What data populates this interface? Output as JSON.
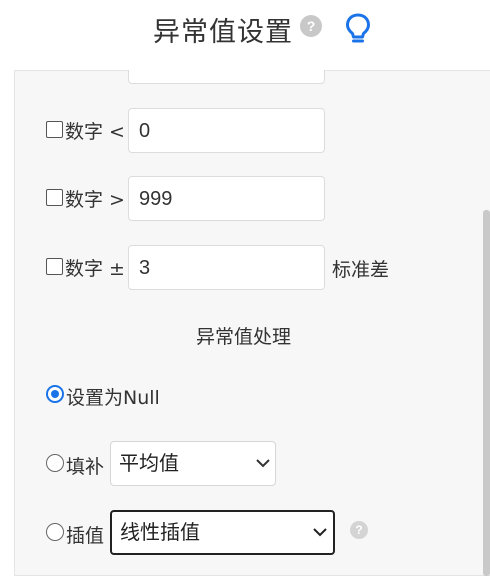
{
  "header": {
    "title": "异常值设置",
    "help_glyph": "?",
    "bulb_icon": "lightbulb-icon",
    "accent_color": "#1a73e8"
  },
  "rules": {
    "lt": {
      "label": "数字 <",
      "value": "0",
      "checked": false
    },
    "gt": {
      "label": "数字 >",
      "value": "999",
      "checked": false
    },
    "std": {
      "label": "数字 ±",
      "value": "3",
      "unit": "标准差",
      "checked": false
    }
  },
  "handling": {
    "title": "异常值处理",
    "set_null": {
      "label": "设置为Null",
      "selected": true
    },
    "fill": {
      "label": "填补",
      "selected": false,
      "option": "平均值"
    },
    "interpolate": {
      "label": "插值",
      "selected": false,
      "option": "线性插值",
      "help_glyph": "?"
    }
  }
}
